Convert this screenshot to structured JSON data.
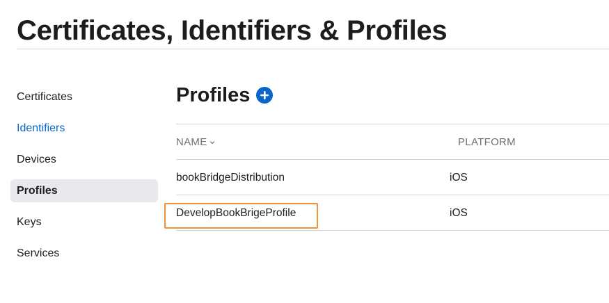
{
  "page": {
    "title": "Certificates, Identifiers & Profiles"
  },
  "sidebar": {
    "items": [
      {
        "label": "Certificates",
        "active": false,
        "link": false
      },
      {
        "label": "Identifiers",
        "active": false,
        "link": true
      },
      {
        "label": "Devices",
        "active": false,
        "link": false
      },
      {
        "label": "Profiles",
        "active": true,
        "link": false
      },
      {
        "label": "Keys",
        "active": false,
        "link": false
      },
      {
        "label": "Services",
        "active": false,
        "link": false
      }
    ]
  },
  "main": {
    "section_title": "Profiles",
    "add_icon": "plus-circle-icon",
    "table": {
      "columns": [
        {
          "label": "NAME",
          "sortable": true,
          "sort_icon": "chevron-down-icon"
        },
        {
          "label": "PLATFORM",
          "sortable": false
        }
      ],
      "rows": [
        {
          "name": "bookBridgeDistribution",
          "platform": "iOS",
          "highlighted": false
        },
        {
          "name": "DevelopBookBrigeProfile",
          "platform": "iOS",
          "highlighted": true
        }
      ]
    }
  },
  "colors": {
    "accent": "#0a66c8",
    "active_background": "#e8e8ed",
    "highlight_border": "#f0903a",
    "divider": "#d2d2d7",
    "muted_text": "#6e6e73",
    "text": "#1d1d1f"
  }
}
